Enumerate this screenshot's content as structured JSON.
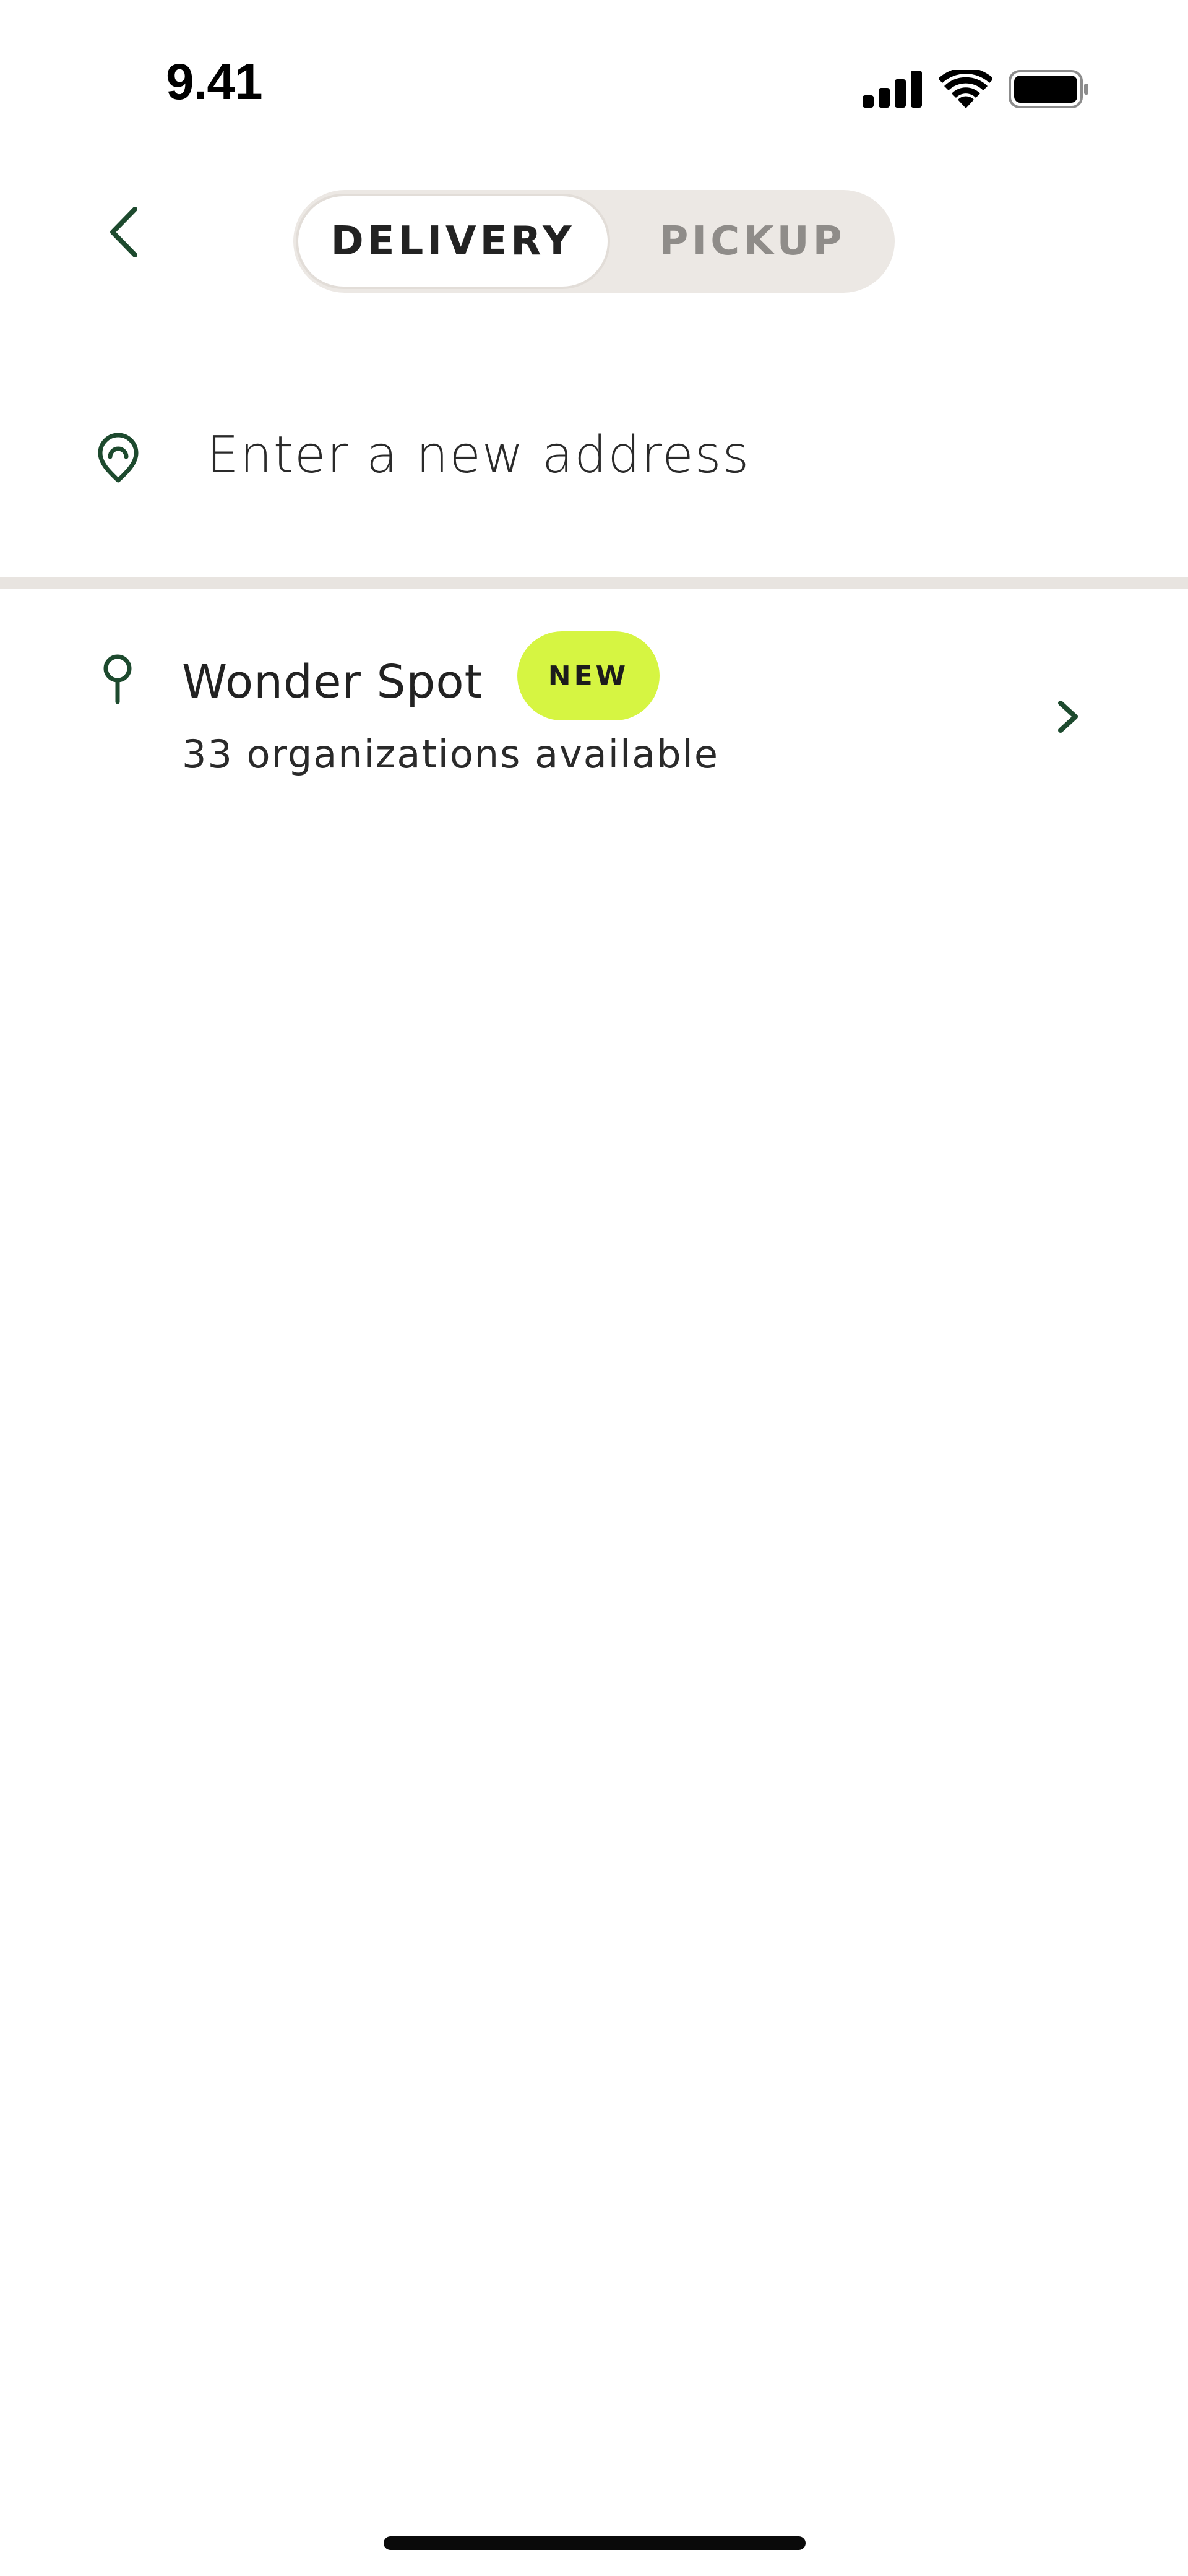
{
  "status_bar": {
    "time": "9.41",
    "icons": [
      "signal-icon",
      "wifi-icon",
      "battery-icon"
    ]
  },
  "header": {
    "back_icon": "chevron-left-icon",
    "tabs": [
      {
        "label": "DELIVERY",
        "active": true
      },
      {
        "label": "PICKUP",
        "active": false
      }
    ]
  },
  "address": {
    "icon": "location-pin-icon",
    "placeholder": "Enter a new address",
    "value": ""
  },
  "locations": [
    {
      "name": "Wonder Spot",
      "badge": "NEW",
      "subtitle": "33 organizations available",
      "icon": "map-pin-icon",
      "action_icon": "chevron-right-icon"
    }
  ],
  "colors": {
    "accent_green": "#1d4a2e",
    "badge_lime": "#d6f542",
    "toggle_bg": "#ece8e4",
    "divider": "#e8e4e0",
    "inactive_text": "#8f8c89"
  }
}
